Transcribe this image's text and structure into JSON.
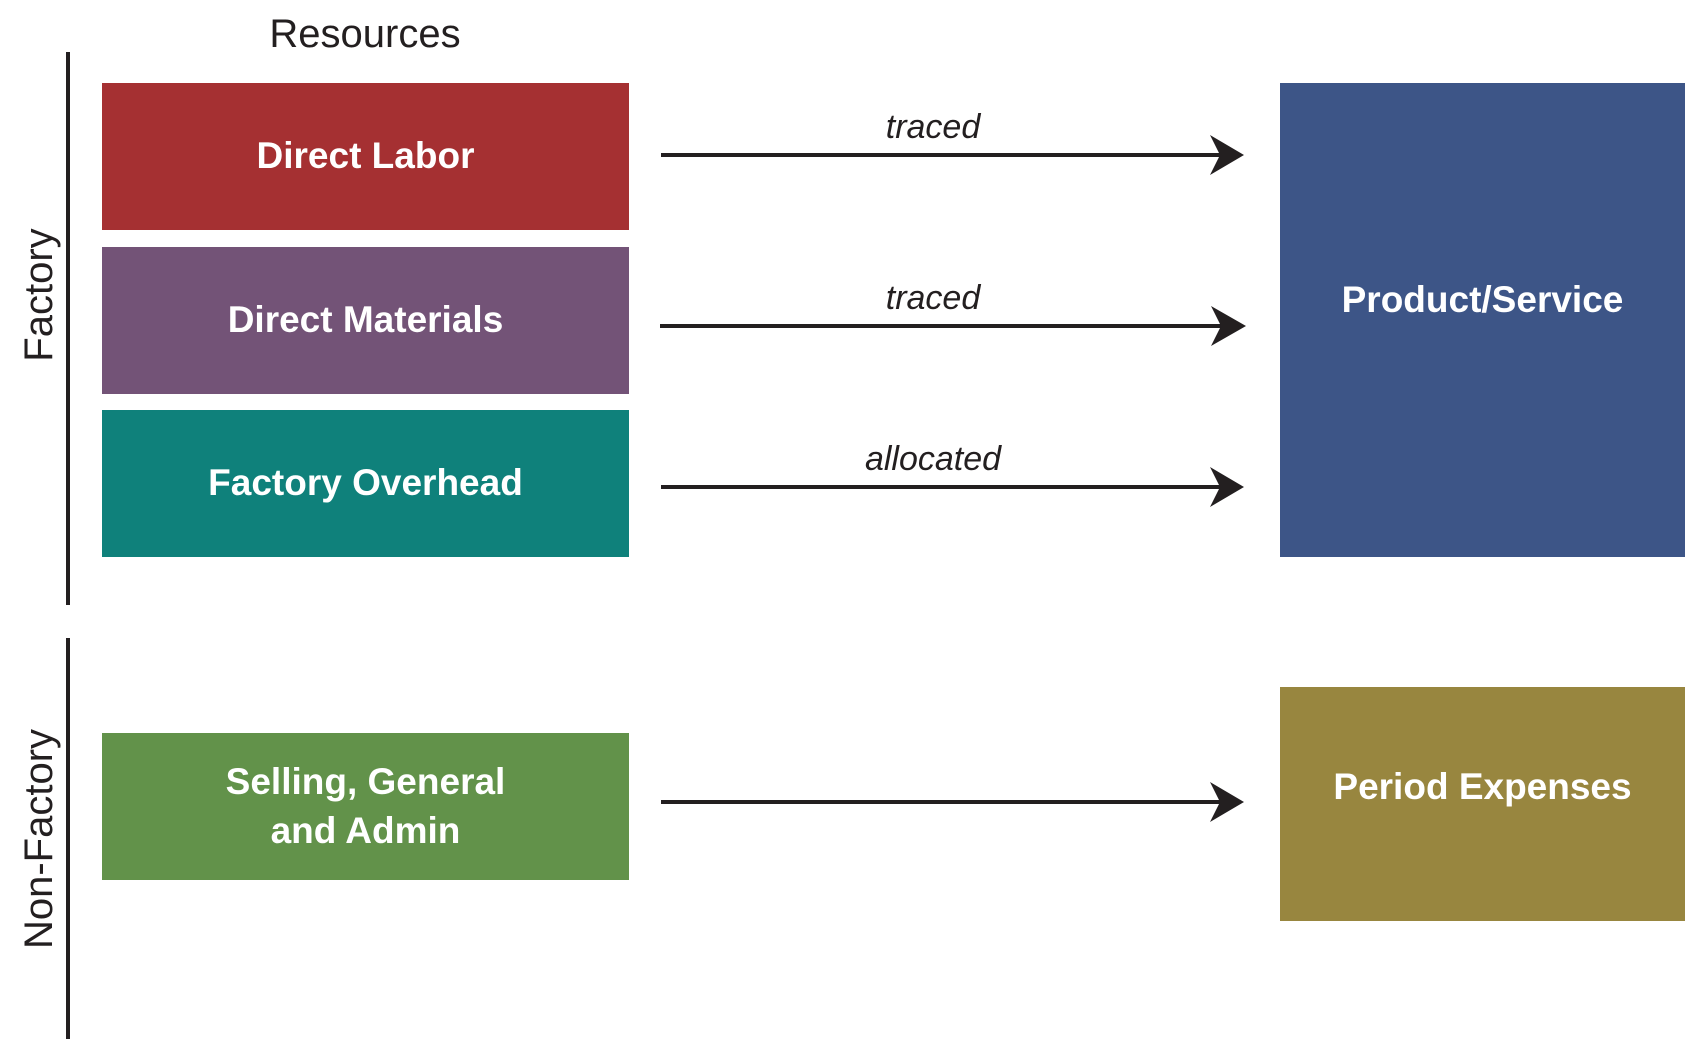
{
  "title": "Resources",
  "groups": {
    "factory": {
      "label": "Factory"
    },
    "non_factory": {
      "label": "Non-Factory"
    }
  },
  "resources": [
    {
      "label": "Direct Labor",
      "color": "#a53032"
    },
    {
      "label": "Direct Materials",
      "color": "#735377"
    },
    {
      "label": "Factory Overhead",
      "color": "#0f817b"
    },
    {
      "label": "Selling, General\nand Admin",
      "label_line1": "Selling, General",
      "label_line2": "and Admin",
      "color": "#62924a"
    }
  ],
  "destinations": [
    {
      "label": "Product/Service",
      "color": "#3d5587"
    },
    {
      "label": "Period Expenses",
      "color": "#98863f"
    }
  ],
  "arrows": [
    {
      "from": "Direct Labor",
      "to": "Product/Service",
      "label": "traced"
    },
    {
      "from": "Direct Materials",
      "to": "Product/Service",
      "label": "traced"
    },
    {
      "from": "Factory Overhead",
      "to": "Product/Service",
      "label": "allocated"
    },
    {
      "from": "Selling, General and Admin",
      "to": "Period Expenses",
      "label": ""
    }
  ],
  "colors": {
    "line": "#231f20",
    "text_on_box": "#ffffff"
  }
}
